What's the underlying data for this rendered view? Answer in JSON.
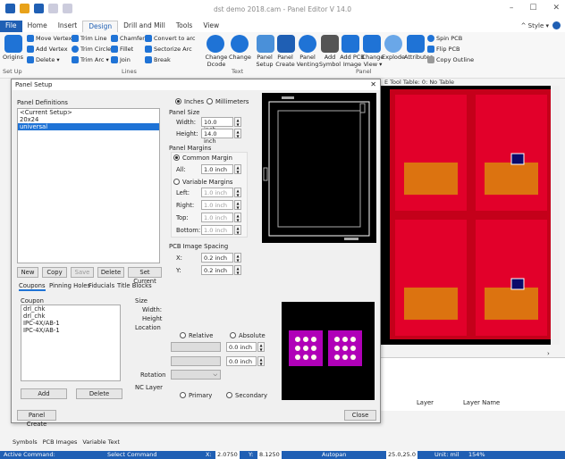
{
  "app": {
    "title": "dst demo 2018.cam - Panel Editor  V 14.0",
    "style_label": "^ Style ▾"
  },
  "tabs": [
    "File",
    "Home",
    "Insert",
    "Design",
    "Drill and Mill",
    "Tools",
    "View"
  ],
  "active_tab": "Design",
  "ribbon": {
    "move_vertex": "Move Vertex",
    "add_vertex": "Add Vertex",
    "delete": "Delete ▾",
    "trim_line": "Trim Line",
    "trim_circle": "Trim Circle",
    "trim_arc": "Trim Arc ▾",
    "chamfer": "Chamfer",
    "fillet": "Fillet",
    "join": "Join",
    "convert_arc": "Convert to arc",
    "sectorize_arc": "Sectorize Arc",
    "break": "Break",
    "change_dcode": "Change Dcode",
    "change": "Change",
    "origins": "Origins",
    "panel_setup": "Panel Setup",
    "panel_create": "Panel Create",
    "panel_venting": "Panel Venting",
    "add_symbol": "Add Symbol",
    "add_pcb_image": "Add PCB Image",
    "change_view": "Change View ▾",
    "explode": "Explode",
    "attributes": "Attributes",
    "spin_pcb": "Spin PCB",
    "flip_pcb": "Flip PCB",
    "copy_outline": "Copy Outline",
    "groups": {
      "setup": "Set Up",
      "lines": "Lines",
      "text": "Text",
      "panel": "Panel"
    }
  },
  "cad_status": "E Tool Table: 0: No Table",
  "dialog": {
    "title": "Panel Setup",
    "definitions_label": "Panel Definitions",
    "definitions": [
      "<Current Setup>",
      "20x24",
      "universal"
    ],
    "selected_definition": "universal",
    "units": {
      "inches": "Inches",
      "mm": "Millimeters",
      "selected": "Inches"
    },
    "panel_size": {
      "label": "Panel Size",
      "width_label": "Width:",
      "width": "10.0 inch",
      "height_label": "Height:",
      "height": "14.0 inch"
    },
    "margins": {
      "label": "Panel Margins",
      "common": "Common Margin",
      "all_label": "All:",
      "all": "1.0 inch",
      "variable": "Variable Margins",
      "left_label": "Left:",
      "left": "1.0 inch",
      "right_label": "Right:",
      "right": "1.0 inch",
      "top_label": "Top:",
      "top": "1.0 inch",
      "bottom_label": "Bottom:",
      "bottom": "1.0 inch"
    },
    "spacing": {
      "label": "PCB Image Spacing",
      "x_label": "X:",
      "x": "0.2 inch",
      "y_label": "Y:",
      "y": "0.2 inch"
    },
    "buttons": {
      "new": "New",
      "copy": "Copy",
      "save": "Save",
      "delete": "Delete",
      "set_current": "Set Current"
    },
    "coupon_tabs": [
      "Coupons",
      "Pinning Holes",
      "Fiducials",
      "Title Blocks"
    ],
    "coupon_label": "Coupon",
    "coupons": [
      "drl_chk",
      "drl_chk",
      "IPC-4X/AB-1",
      "IPC-4X/AB-1"
    ],
    "size_label": "Size",
    "width_label": "Width:",
    "height_label": "Height",
    "location_label": "Location",
    "relative": "Relative",
    "absolute": "Absolute",
    "loc_x": "0.0 inch",
    "loc_y": "0.0 inch",
    "rotation_label": "Rotation",
    "nc_layer_label": "NC Layer",
    "primary": "Primary",
    "secondary": "Secondary",
    "add": "Add",
    "delete": "Delete",
    "panel_create": "Panel Create",
    "close": "Close"
  },
  "layers_header": {
    "layer": "Layer",
    "layer_name": "Layer Name"
  },
  "bottom_tabs": [
    "Symbols",
    "PCB Images",
    "Variable Text"
  ],
  "status": {
    "active_command": "Active Command:",
    "command": "Select Command",
    "x_label": "X:",
    "x": "2.0750",
    "y_label": "Y:",
    "y": "8.1250",
    "autopan": "Autopan",
    "grid": "25.0,25.0",
    "unit": "Unit: mil",
    "zoom": "154%"
  }
}
